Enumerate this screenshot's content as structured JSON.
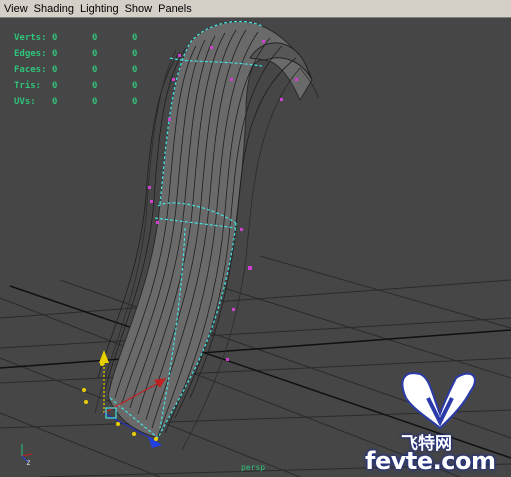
{
  "menu": {
    "items": [
      "View",
      "Shading",
      "Lighting",
      "Show",
      "Panels"
    ]
  },
  "hud": {
    "rows": [
      {
        "label": "Verts:",
        "values": [
          "0",
          "0",
          "0"
        ]
      },
      {
        "label": "Edges:",
        "values": [
          "0",
          "0",
          "0"
        ]
      },
      {
        "label": "Faces:",
        "values": [
          "0",
          "0",
          "0"
        ]
      },
      {
        "label": "Tris:",
        "values": [
          "0",
          "0",
          "0"
        ]
      },
      {
        "label": "UVs:",
        "values": [
          "0",
          "0",
          "0"
        ]
      }
    ]
  },
  "viewport": {
    "camera_label": "persp",
    "axis_label": "z"
  },
  "watermark": {
    "chinese": "飞特网",
    "url": "fevte.com"
  },
  "colors": {
    "background": "#464646",
    "grid": "#2b2b2b",
    "grid_axis": "#101010",
    "hud_text": "#2fc27a",
    "selection": "#45e0e0",
    "cv": "#d040d0"
  }
}
